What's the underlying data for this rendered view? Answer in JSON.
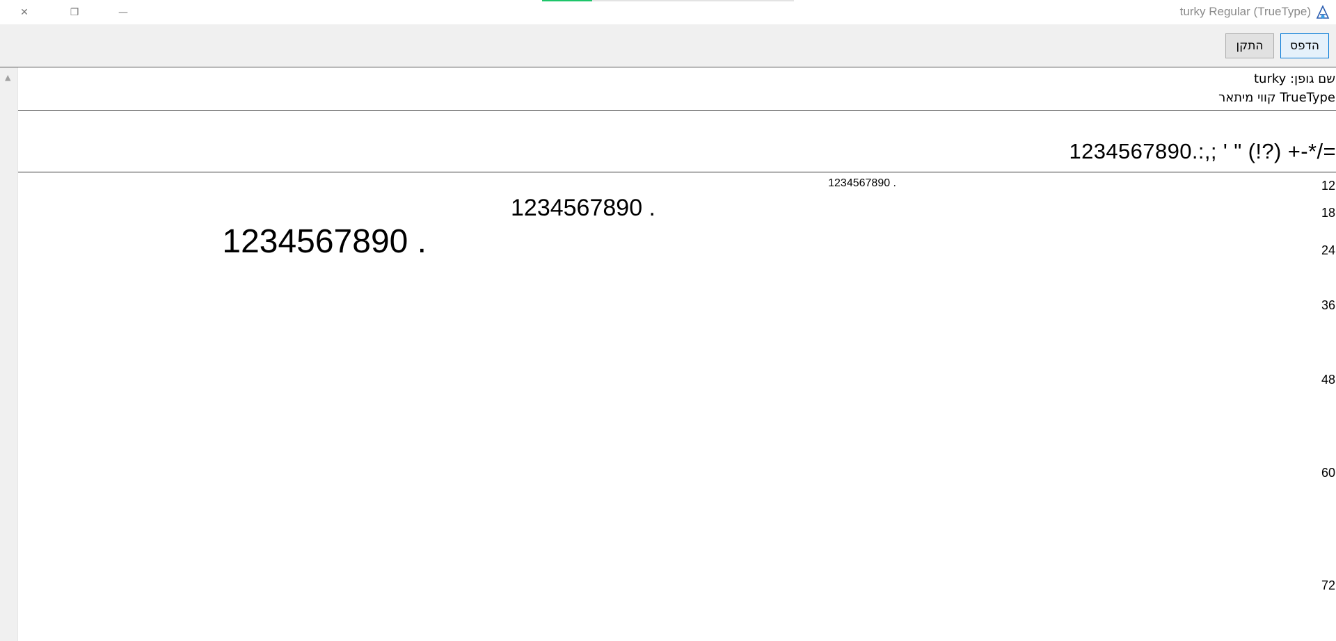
{
  "window": {
    "title": "turky Regular (TrueType)",
    "app_icon": "font-viewer-icon",
    "controls": {
      "close": "✕",
      "restore": "❐",
      "minimize": "—"
    },
    "accent_color": "#1ec56a"
  },
  "toolbar": {
    "print_label": "הדפס",
    "install_label": "התקן"
  },
  "info": {
    "font_name": "שם גופן: turky",
    "font_type": "TrueType קווי מיתאר"
  },
  "preview": {
    "charset": "1234567890.:,; ' \" (!?) +-*/=",
    "sizes": [
      "12",
      "18",
      "24",
      "36",
      "48",
      "60",
      "72"
    ],
    "sample_text": "1234567890 ."
  }
}
